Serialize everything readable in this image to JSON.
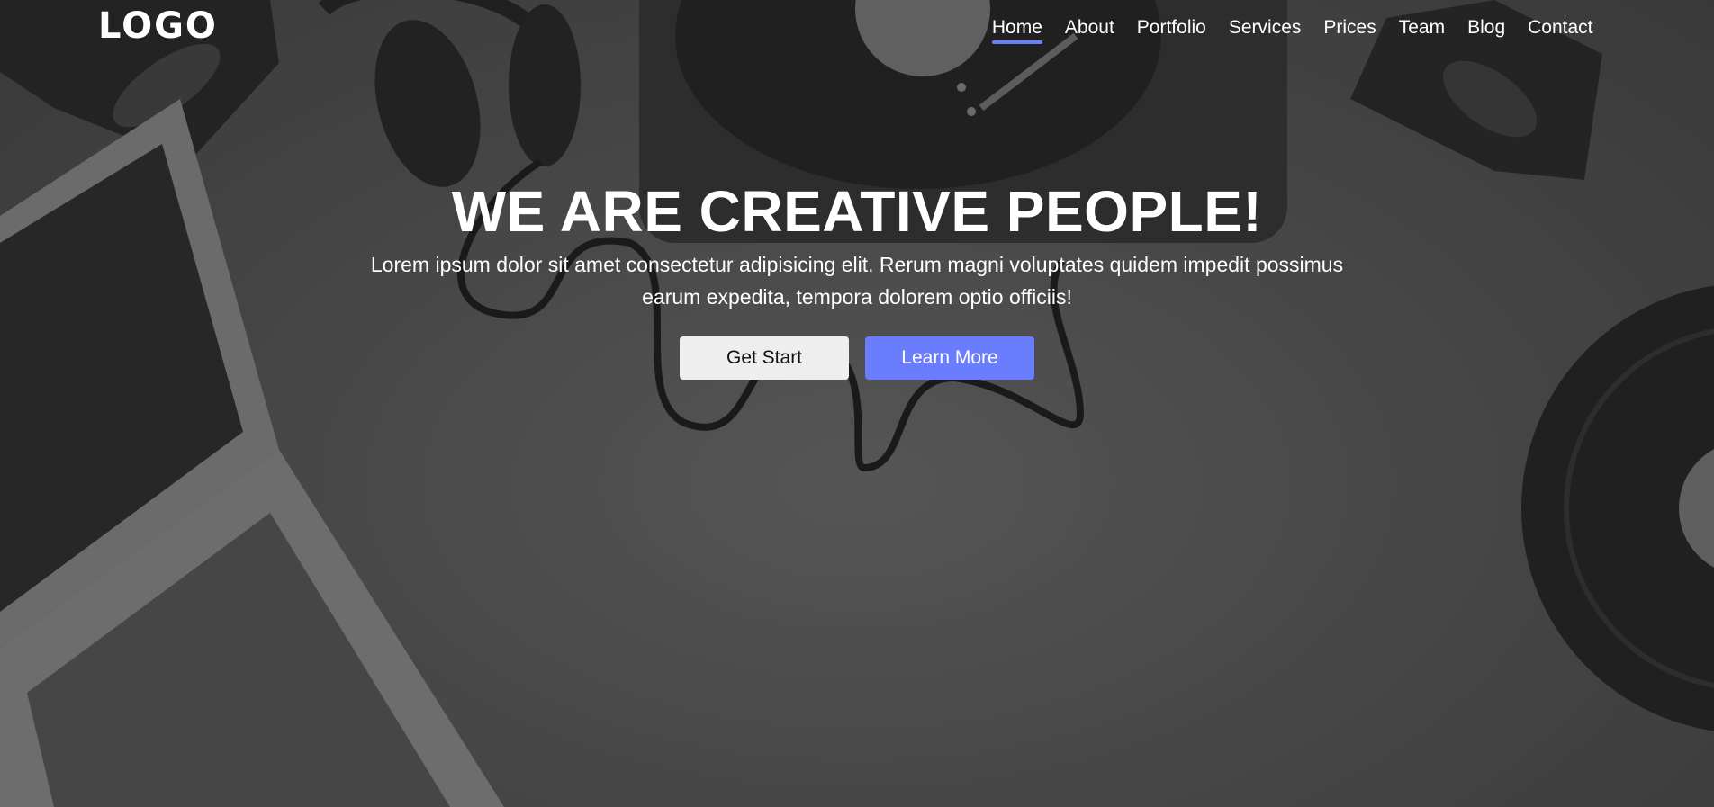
{
  "header": {
    "logo_text": "LOGO",
    "nav": [
      {
        "label": "Home",
        "active": true
      },
      {
        "label": "About"
      },
      {
        "label": "Portfolio"
      },
      {
        "label": "Services"
      },
      {
        "label": "Prices"
      },
      {
        "label": "Team"
      },
      {
        "label": "Blog"
      },
      {
        "label": "Contact"
      }
    ]
  },
  "hero": {
    "title": "WE ARE CREATIVE PEOPLE!",
    "subtitle": "Lorem ipsum dolor sit amet consectetur adipisicing elit. Rerum magni voluptates quidem impedit possimus earum expedita, tempora dolorem optio officiis!",
    "primary_button_label": "Get Start",
    "secondary_button_label": "Learn More"
  },
  "colors": {
    "accent": "#6a7dff",
    "light_button": "#eeeeee"
  }
}
